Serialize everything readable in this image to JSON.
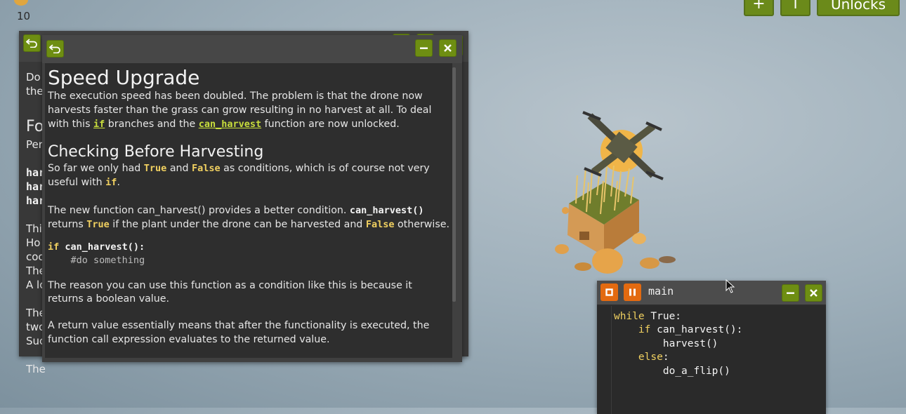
{
  "resource": {
    "count": "10",
    "icon": "coin-icon"
  },
  "top_buttons": {
    "add_label": "+",
    "info_label": "i",
    "unlocks_label": "Unlocks"
  },
  "back_window": {
    "lines": [
      "Do",
      "the",
      "",
      "Fo",
      "Per",
      "",
      "har",
      "har",
      "har",
      "",
      "Thi",
      "Ho",
      "coo",
      "The",
      "A lo",
      "",
      "The",
      "two",
      "Suc",
      "",
      "The"
    ]
  },
  "doc_window": {
    "title": "Speed Upgrade",
    "p1_a": "The execution speed has been doubled. The problem is that the drone now harvests faster than the grass can grow resulting in no harvest at all. To deal with this ",
    "p1_if": "if",
    "p1_b": " branches and the ",
    "p1_fn": "can_harvest",
    "p1_c": " function are now unlocked.",
    "heading2": "Checking Before Harvesting",
    "p2_a": "So far we only had ",
    "p2_true": "True",
    "p2_b": " and ",
    "p2_false": "False",
    "p2_c": " as conditions, which is of course not very useful with ",
    "p2_if": "if",
    "p2_d": ".",
    "p3_a": "The new function can_harvest() provides a better condition. ",
    "p3_fn": "can_harvest()",
    "p3_b": " returns ",
    "p3_true": "True",
    "p3_c": " if the plant under the drone can be harvested and ",
    "p3_false": "False",
    "p3_d": " otherwise.",
    "code_kw": "if",
    "code_rest": " can_harvest():",
    "code_comment": "    #do something",
    "p4": "The reason you can use this function as a condition like this is because it returns a boolean value.",
    "p5": "A return value essentially means that after the functionality is executed, the function call expression evaluates to the returned value."
  },
  "code_window": {
    "title": "main",
    "lines": [
      {
        "kw": "while",
        "rest": " True:"
      },
      {
        "kw": "    if",
        "rest": " can_harvest():"
      },
      {
        "kw": "",
        "rest": "        harvest()"
      },
      {
        "kw": "    else",
        "rest": ":"
      },
      {
        "kw": "",
        "rest": "        do_a_flip()"
      }
    ]
  },
  "colors": {
    "green_button": "#6e8e12",
    "orange_button": "#e36a10",
    "keyword": "#f0d060",
    "link": "#c9de3c"
  }
}
